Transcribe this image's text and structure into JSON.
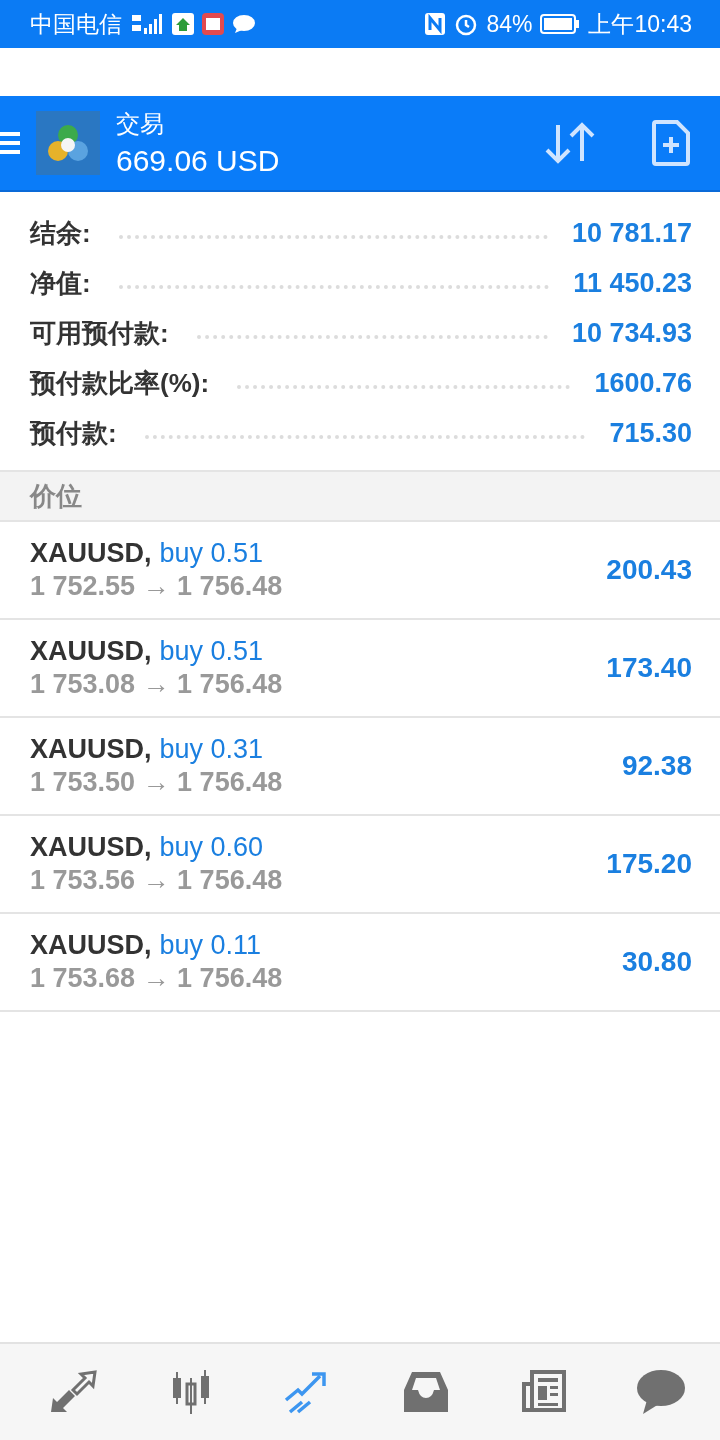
{
  "status_bar": {
    "carrier": "中国电信",
    "battery": "84%",
    "time": "上午10:43"
  },
  "header": {
    "title": "交易",
    "balance": "669.06 USD"
  },
  "summary": [
    {
      "label": "结余:",
      "value": "10 781.17"
    },
    {
      "label": "净值:",
      "value": "11 450.23"
    },
    {
      "label": "可用预付款:",
      "value": "10 734.93"
    },
    {
      "label": "预付款比率(%):",
      "value": "1600.76"
    },
    {
      "label": "预付款:",
      "value": "715.30"
    }
  ],
  "section": {
    "title": "价位"
  },
  "positions": [
    {
      "symbol": "XAUUSD,",
      "order": "buy 0.51",
      "prices": "1 752.55 → 1 756.48",
      "profit": "200.43"
    },
    {
      "symbol": "XAUUSD,",
      "order": "buy 0.51",
      "prices": "1 753.08 → 1 756.48",
      "profit": "173.40"
    },
    {
      "symbol": "XAUUSD,",
      "order": "buy 0.31",
      "prices": "1 753.50 → 1 756.48",
      "profit": "92.38"
    },
    {
      "symbol": "XAUUSD,",
      "order": "buy 0.60",
      "prices": "1 753.56 → 1 756.48",
      "profit": "175.20"
    },
    {
      "symbol": "XAUUSD,",
      "order": "buy 0.11",
      "prices": "1 753.68 → 1 756.48",
      "profit": "30.80"
    }
  ],
  "bottom_nav": [
    {
      "kind": "quotes",
      "selected": false
    },
    {
      "kind": "chart",
      "selected": false
    },
    {
      "kind": "trade",
      "selected": true
    },
    {
      "kind": "history",
      "selected": false
    },
    {
      "kind": "news",
      "selected": false
    },
    {
      "kind": "chat",
      "selected": false
    }
  ]
}
